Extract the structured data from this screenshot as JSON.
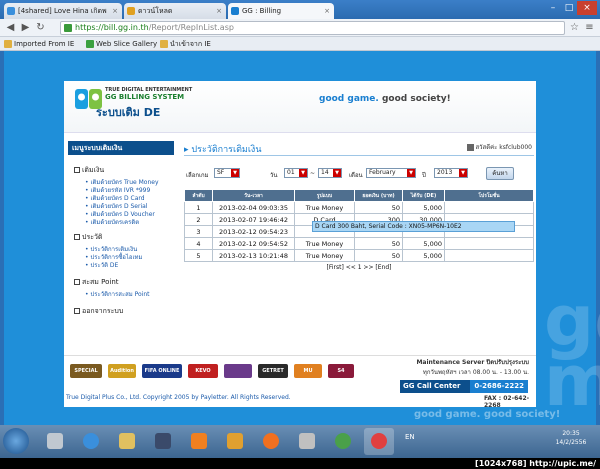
{
  "browser": {
    "tabs": [
      {
        "label": "[4shared] Love Hina เกิดพ",
        "active": false
      },
      {
        "label": "ดาวน์โหลด",
        "active": false
      },
      {
        "label": "GG : Billing",
        "active": true
      }
    ],
    "url_scheme": "https://",
    "url_host": "bill.gg.in.th",
    "url_path": "/Report/RepInList.asp",
    "bookmarks": [
      "Imported From IE",
      "Web Slice Gallery",
      "นำเข้าจาก IE"
    ]
  },
  "header": {
    "brand_line1": "TRUE DIGITAL ENTERTAINMENT",
    "brand_line2": "GG BILLING SYSTEM",
    "brand_line3": "ระบบเติม DE",
    "slogan_a": "good game.",
    "slogan_b": "good society!"
  },
  "sidebar": {
    "heading": "เมนูระบบเติมเงิน",
    "sections": [
      {
        "label": "เติมเงิน",
        "items": [
          "เติมด้วยบัตร True Money",
          "เติมด้วยรหัส IVR *999",
          "เติมด้วยบัตร D Card",
          "เติมด้วยบัตร D Serial",
          "เติมด้วยบัตร D Voucher",
          "เติมด้วยบัตรเครดิต"
        ]
      },
      {
        "label": "ประวัติ",
        "items": [
          "ประวัติการเติมเงิน",
          "ประวัติการซื้อไอเทม",
          "ประวัติ DE"
        ]
      },
      {
        "label": "สะสม Point",
        "items": [
          "ประวัติการสะสม Point"
        ]
      },
      {
        "label": "ออกจากระบบ",
        "items": []
      }
    ]
  },
  "main": {
    "title": "ประวัติการเติมเงิน",
    "user_label": "สวัสดีค่ะ ksfclub000",
    "filters": {
      "game_label": "เลือกเกม",
      "game_value": "SF",
      "day_label": "วัน",
      "day_from": "01",
      "day_sep": "~",
      "day_to": "14",
      "month_label": "เดือน",
      "month_value": "February",
      "year_label": "ปี",
      "year_value": "2013",
      "search_label": "ค้นหา"
    },
    "columns": [
      "ลำดับ",
      "วัน-เวลา",
      "รูปแบบ",
      "ยอดเงิน (บาท)",
      "ได้รับ (DE)",
      "โปรโมชั่น"
    ],
    "rows": [
      {
        "no": "1",
        "datetime": "2013-02-04 09:03:35",
        "type": "True Money",
        "amount": "50",
        "de": "5,000",
        "promo": ""
      },
      {
        "no": "2",
        "datetime": "2013-02-07 19:46:42",
        "type": "D Card",
        "amount": "300",
        "de": "30,000",
        "promo": ""
      },
      {
        "no": "3",
        "datetime": "2013-02-12 09:54:23",
        "type": "",
        "amount": "",
        "de": "",
        "promo": ""
      },
      {
        "no": "4",
        "datetime": "2013-02-12 09:54:52",
        "type": "True Money",
        "amount": "50",
        "de": "5,000",
        "promo": ""
      },
      {
        "no": "5",
        "datetime": "2013-02-13 10:21:48",
        "type": "True Money",
        "amount": "50",
        "de": "5,000",
        "promo": ""
      }
    ],
    "tooltip": "D Card 300 Baht, Serial Code : XN05-MP6N-10E2",
    "pager": "[First] <<  1  >> [End]"
  },
  "footer": {
    "games": [
      "SPECIAL FORCE",
      "Audition",
      "FIFA ONLINE 3",
      "KEVO",
      "",
      "GETRET",
      "MU",
      "S4"
    ],
    "maintenance_title": "Maintenance Server ปิดปรับปรุงระบบ",
    "maintenance_time": "ทุกวันพฤหัสฯ เวลา 08.00 น. - 13.00 น.",
    "call_center_label": "GG Call Center",
    "call_center_number": "0-2686-2222",
    "fax": "FAX : 02-642-2268",
    "copyright": "True Digital Plus Co., Ltd.  Copyright 2005 by Payletter. All Rights Reserved.",
    "watermark_slogan": "good game. good society!"
  },
  "taskbar": {
    "lang": "EN",
    "time": "20:35",
    "date": "14/2/2556"
  },
  "caption": "[1024x768] http://upic.me/"
}
